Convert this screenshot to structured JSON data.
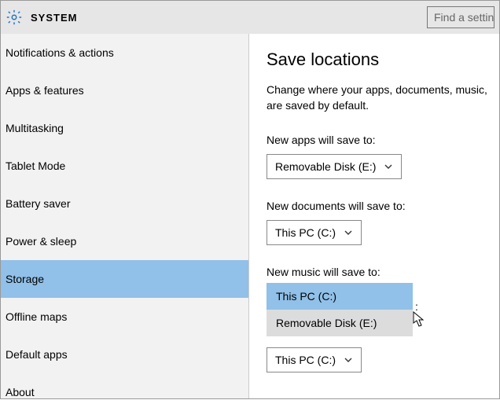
{
  "header": {
    "title": "SYSTEM",
    "search_placeholder": "Find a setting"
  },
  "sidebar": {
    "items": [
      {
        "label": "Notifications & actions",
        "selected": false
      },
      {
        "label": "Apps & features",
        "selected": false
      },
      {
        "label": "Multitasking",
        "selected": false
      },
      {
        "label": "Tablet Mode",
        "selected": false
      },
      {
        "label": "Battery saver",
        "selected": false
      },
      {
        "label": "Power & sleep",
        "selected": false
      },
      {
        "label": "Storage",
        "selected": true
      },
      {
        "label": "Offline maps",
        "selected": false
      },
      {
        "label": "Default apps",
        "selected": false
      },
      {
        "label": "About",
        "selected": false
      }
    ]
  },
  "main": {
    "title": "Save locations",
    "description": "Change where your apps, documents, music, are saved by default.",
    "fields": [
      {
        "label": "New apps will save to:",
        "value": "Removable Disk (E:)"
      },
      {
        "label": "New documents will save to:",
        "value": "This PC (C:)"
      },
      {
        "label": "New music will save to:",
        "value": "This PC (C:)",
        "open_options": [
          {
            "label": "This PC (C:)",
            "state": "selected"
          },
          {
            "label": "Removable Disk (E:)",
            "state": "hover"
          }
        ]
      }
    ],
    "extra_dropdown_value": "This PC (C:)"
  }
}
